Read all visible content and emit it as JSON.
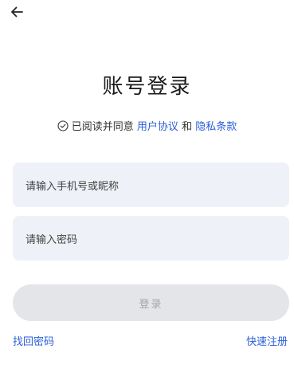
{
  "header": {
    "back_icon": "arrow-left-icon"
  },
  "title": "账号登录",
  "agreement": {
    "check_icon": "circle-check-icon",
    "prefix": "已阅读并同意",
    "terms_link": "用户协议",
    "connector": "和",
    "privacy_link": "隐私条款",
    "link_color": "#2b5fd9"
  },
  "form": {
    "username_placeholder": "请输入手机号或昵称",
    "password_placeholder": "请输入密码",
    "login_label": "登录"
  },
  "footer": {
    "forgot_label": "找回密码",
    "register_label": "快速注册"
  }
}
